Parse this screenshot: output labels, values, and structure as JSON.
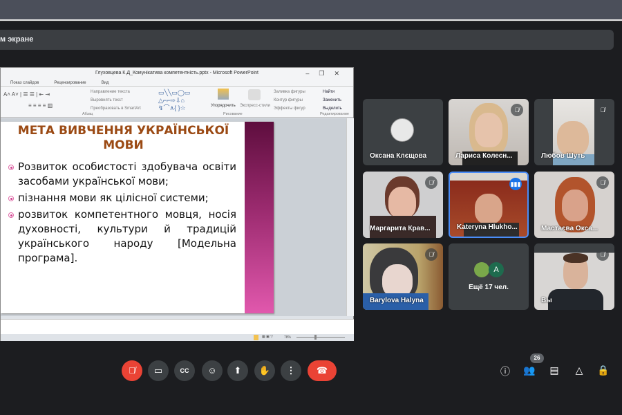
{
  "banner": {
    "text": "м экране"
  },
  "ppt": {
    "title": "Глуховцева К.Д_Комунікатива компетентність.pptx - Microsoft PowerPoint",
    "tabs": [
      "Показ слайдов",
      "Рецензирование",
      "Вид"
    ],
    "ribbon": {
      "text_direction": "Направление текста",
      "align_text": "Выровнять текст",
      "smartart": "Преобразовать в SmartArt",
      "arrange": "Упорядочить",
      "quick_styles": "Экспресс-стили",
      "shape_fill": "Заливка фигуры",
      "shape_outline": "Контур фигуры",
      "shape_effects": "Эффекты фигур",
      "find": "Найти",
      "replace": "Заменить",
      "select": "Выделить",
      "group_paragraph": "Абзац",
      "group_drawing": "Рисование",
      "group_editing": "Редактирование"
    },
    "slide": {
      "title": "МЕТА ВИВЧЕННЯ УКРАЇНСЬКОЇ МОВИ",
      "bullets": [
        "Розвиток особистості здобувача освіти засобами української мови;",
        "пізнання мови як цілісної системи;",
        "розвиток компетентного мовця, носія духовності, культури й традицій українського народу [Модельна програма]."
      ]
    },
    "zoom": "78%"
  },
  "participants": [
    {
      "name": "Оксана Клєщова",
      "muted": false
    },
    {
      "name": "Лариса Колесн...",
      "muted": true
    },
    {
      "name": "Любов Шуть",
      "muted": true
    },
    {
      "name": "Маргарита Крав...",
      "muted": true
    },
    {
      "name": "Kateryna Hlukho...",
      "speaking": true
    },
    {
      "name": "Мастаєва Окса...",
      "muted": true
    },
    {
      "name": "Barylova Halyna",
      "muted": true
    },
    {
      "name": "Ещё 17 чел.",
      "avatar_letter": "A"
    },
    {
      "name": "Вы",
      "muted": true
    }
  ],
  "people_count": "26",
  "colors": {
    "danger": "#ea4335",
    "speaking": "#4285f4",
    "avatar_green": "#1e6b4e"
  }
}
